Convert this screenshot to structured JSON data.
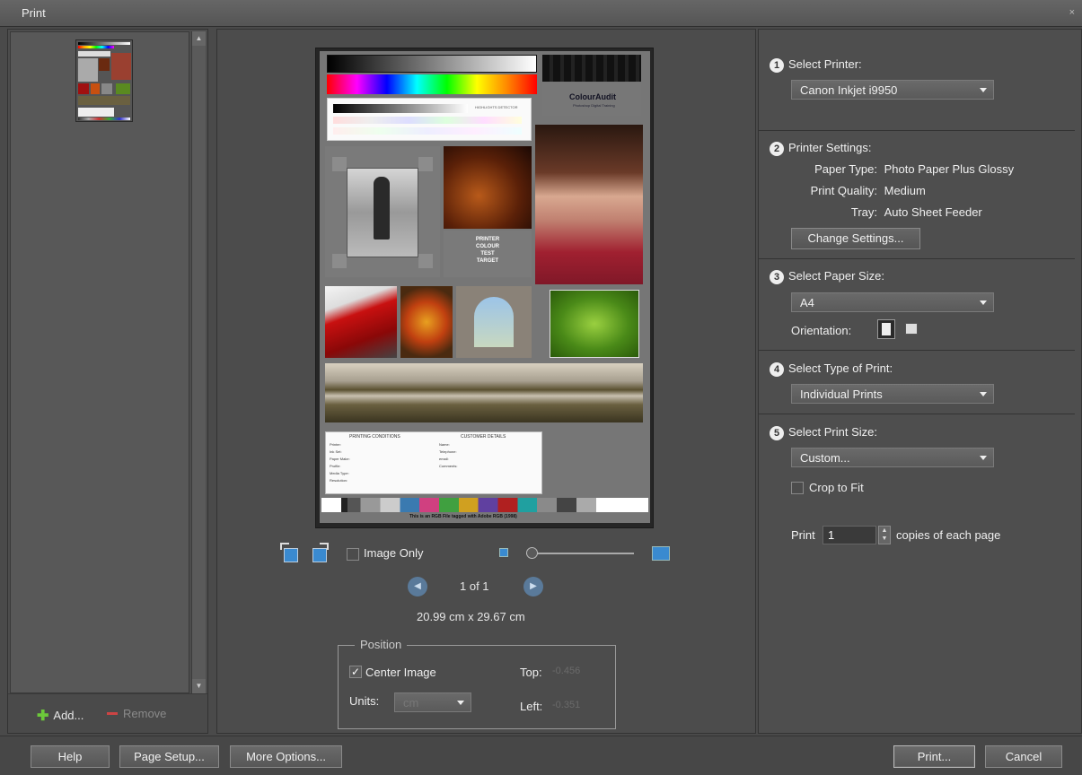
{
  "window": {
    "title": "Print",
    "close": "×"
  },
  "left": {
    "add_label": "Add...",
    "remove_label": "Remove",
    "scroll_up": "▲",
    "scroll_down": "▼"
  },
  "center": {
    "image_only_label": "Image Only",
    "page_counter": "1 of 1",
    "page_size": "20.99 cm x 29.67 cm",
    "prev_glyph": "◀",
    "next_glyph": "▶",
    "position": {
      "legend": "Position",
      "center_image_label": "Center Image",
      "center_image_checked": true,
      "units_label": "Units:",
      "units_value": "cm",
      "top_label": "Top:",
      "top_value": "-0.456",
      "left_label": "Left:",
      "left_value": "-0.351"
    },
    "page_text": {
      "logo_main": "ColourAudit",
      "logo_sub": "Photoshop Digital Training",
      "highlights": "HIGHLIGHTS DETECTOR",
      "target_title": [
        "PRINTER",
        "COLOUR",
        "TEST",
        "TARGET"
      ],
      "form_left_title": "PRINTING CONDITIONS",
      "form_right_title": "CUSTOMER DETAILS",
      "form_left_fields": [
        "Printer:",
        "Ink Set:",
        "Paper Make:",
        "Profile:",
        "Media Type:",
        "Resolution:"
      ],
      "form_right_fields": [
        "Name:",
        "Telephone:",
        "email:",
        "Comments:"
      ],
      "footer": "This is an RGB File tagged with Adobe RGB (1998)"
    }
  },
  "right": {
    "s1": {
      "num": "1",
      "title": "Select Printer:",
      "value": "Canon Inkjet i9950"
    },
    "s2": {
      "num": "2",
      "title": "Printer Settings:",
      "paper_type_label": "Paper Type:",
      "paper_type": "Photo Paper Plus Glossy",
      "quality_label": "Print Quality:",
      "quality": "Medium",
      "tray_label": "Tray:",
      "tray": "Auto Sheet Feeder",
      "change_button": "Change Settings..."
    },
    "s3": {
      "num": "3",
      "title": "Select Paper Size:",
      "value": "A4",
      "orientation_label": "Orientation:"
    },
    "s4": {
      "num": "4",
      "title": "Select Type of Print:",
      "value": "Individual Prints"
    },
    "s5": {
      "num": "5",
      "title": "Select Print Size:",
      "value": "Custom...",
      "crop_label": "Crop to Fit"
    },
    "copies": {
      "prefix": "Print",
      "value": "1",
      "suffix": "copies of each page"
    }
  },
  "footer": {
    "help": "Help",
    "page_setup": "Page Setup...",
    "more_options": "More Options...",
    "print": "Print...",
    "cancel": "Cancel"
  }
}
